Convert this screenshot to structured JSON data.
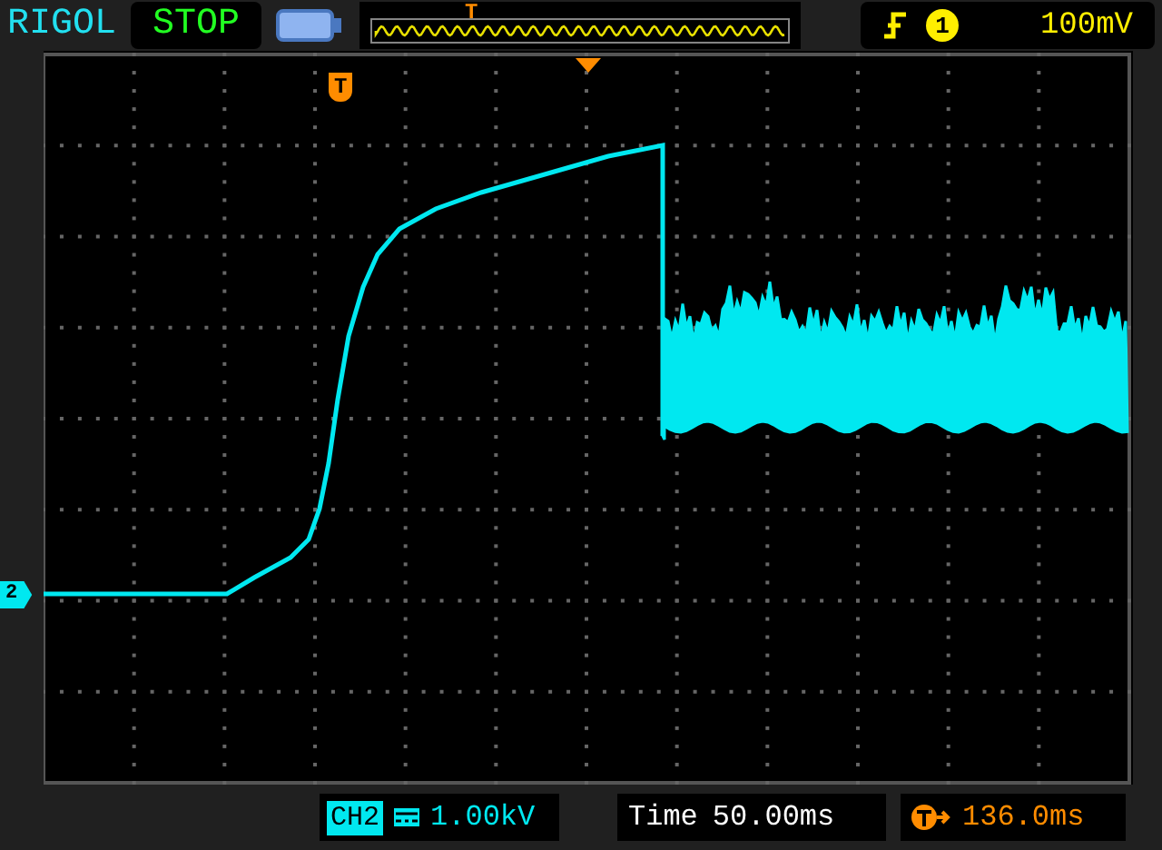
{
  "header": {
    "brand": "RIGOL",
    "run_state": "STOP",
    "memory_trigger_mark": "T",
    "trigger_channel": "1",
    "trigger_level": "100mV"
  },
  "screen": {
    "trigger_position_mark": "T",
    "channel_marker": "2"
  },
  "footer": {
    "channel": "CH2",
    "channel_scale": "1.00kV",
    "time_label": "Time",
    "time_scale": "50.00ms",
    "trigger_offset": "136.0ms"
  }
}
